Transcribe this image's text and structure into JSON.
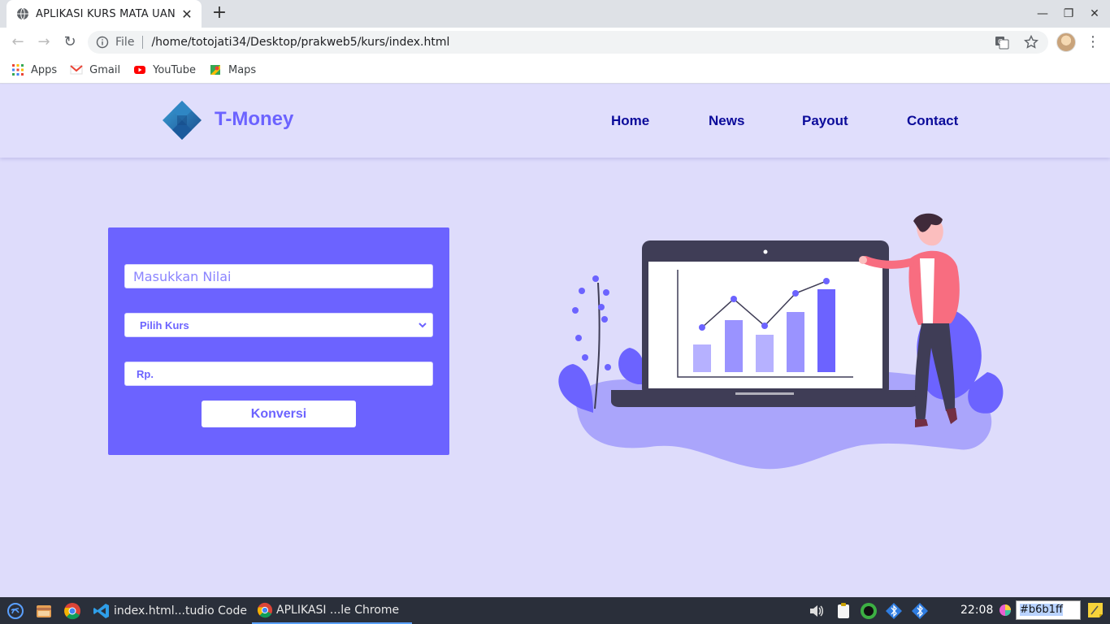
{
  "browser": {
    "tab_title": "APLIKASI KURS MATA UANG",
    "url_scheme": "File",
    "url": "/home/totojati34/Desktop/prakweb5/kurs/index.html",
    "bookmarks": [
      {
        "label": "Apps",
        "icon": "apps-grid-icon"
      },
      {
        "label": "Gmail",
        "icon": "gmail-icon"
      },
      {
        "label": "YouTube",
        "icon": "youtube-icon"
      },
      {
        "label": "Maps",
        "icon": "maps-icon"
      }
    ]
  },
  "site": {
    "brand": "T-Money",
    "nav": [
      "Home",
      "News",
      "Payout",
      "Contact"
    ],
    "form": {
      "value_placeholder": "Masukkan Nilai",
      "currency_placeholder": "Pilih Kurs",
      "result_placeholder": "Rp.",
      "convert_label": "Konversi"
    },
    "colors": {
      "primary": "#6c63ff",
      "background": "#dedcfb",
      "nav_link": "#0b0b9a"
    }
  },
  "taskbar": {
    "items": [
      {
        "label": "index.html...tudio Code",
        "icon": "vscode-icon"
      },
      {
        "label": "APLIKASI ...le Chrome",
        "icon": "chrome-icon"
      }
    ],
    "clock": "22:08",
    "color_value": "#b6b1ff"
  }
}
